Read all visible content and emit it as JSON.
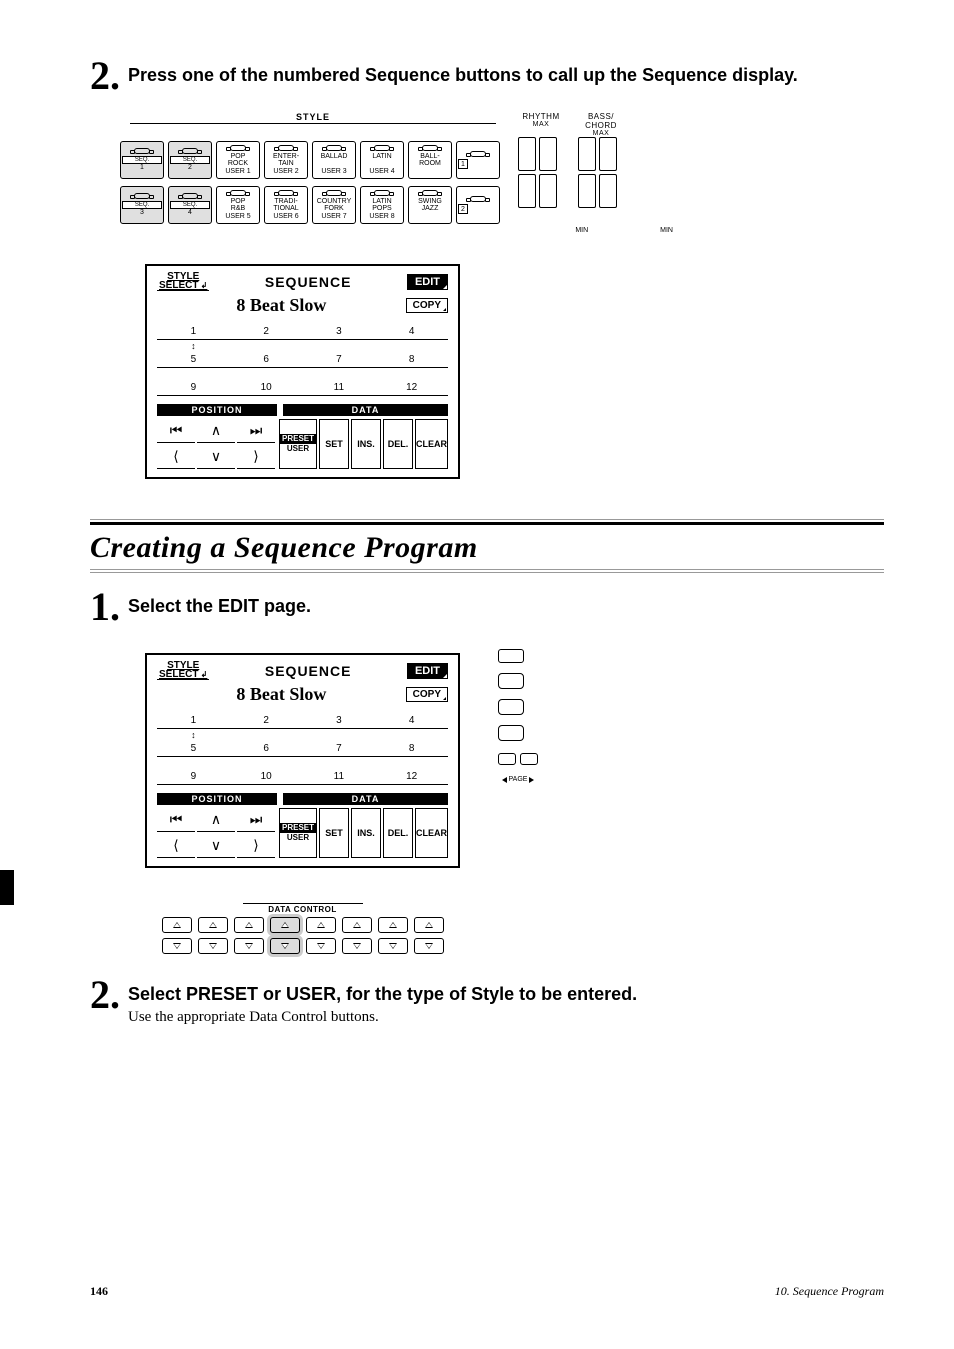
{
  "steps": {
    "s2top": {
      "num": "2.",
      "text": "Press one of the numbered Sequence buttons to call up the Sequence display."
    },
    "s1": {
      "num": "1.",
      "text": "Select the EDIT page."
    },
    "s2bot": {
      "num": "2.",
      "text": "Select PRESET or USER, for the type of Style to be entered.",
      "sub": "Use the appropriate Data Control buttons."
    }
  },
  "section_title": "Creating a Sequence Program",
  "style_panel": {
    "style_label": "STYLE",
    "rhythm_label": "RHYTHM",
    "bass_label": "BASS/\nCHORD",
    "max": "MAX",
    "min": "MIN",
    "row1": [
      {
        "type": "seq",
        "lines": [
          "SEQ.",
          "1"
        ]
      },
      {
        "type": "seq",
        "lines": [
          "SEQ.",
          "2"
        ]
      },
      {
        "type": "std",
        "lines": [
          "POP",
          "ROCK",
          "USER 1"
        ]
      },
      {
        "type": "std",
        "lines": [
          "ENTER-",
          "TAIN",
          "USER 2"
        ]
      },
      {
        "type": "std",
        "lines": [
          "BALLAD",
          "",
          "USER 3"
        ]
      },
      {
        "type": "std",
        "lines": [
          "LATIN",
          "",
          "USER 4"
        ]
      },
      {
        "type": "std",
        "lines": [
          "BALL-",
          "ROOM",
          ""
        ]
      },
      {
        "type": "num",
        "n": "1"
      }
    ],
    "row2": [
      {
        "type": "seq",
        "lines": [
          "SEQ.",
          "3"
        ]
      },
      {
        "type": "seq",
        "lines": [
          "SEQ.",
          "4"
        ]
      },
      {
        "type": "std",
        "lines": [
          "POP",
          "R&B",
          "USER 5"
        ]
      },
      {
        "type": "std",
        "lines": [
          "TRADI-",
          "TIONAL",
          "USER 6"
        ]
      },
      {
        "type": "std",
        "lines": [
          "COUNTRY",
          "FORK",
          "USER 7"
        ]
      },
      {
        "type": "std",
        "lines": [
          "LATIN",
          "POPS",
          "USER 8"
        ]
      },
      {
        "type": "std",
        "lines": [
          "SWING",
          "JAZZ",
          ""
        ]
      },
      {
        "type": "num",
        "n": "2"
      }
    ]
  },
  "seq_display": {
    "style_select": "STYLE\nSELECT",
    "title": "SEQUENCE",
    "edit": "EDIT",
    "style_name": "8 Beat Slow",
    "copy": "COPY",
    "nums": [
      [
        "1",
        "2",
        "3",
        "4"
      ],
      [
        "5",
        "6",
        "7",
        "8"
      ],
      [
        "9",
        "10",
        "11",
        "12"
      ]
    ],
    "position_label": "POSITION",
    "data_label": "DATA",
    "pos_cells": [
      "|⟨⟨",
      "∧",
      "⟩⟩|",
      "⟨",
      "∨",
      "⟩"
    ],
    "data_cells": [
      {
        "type": "split",
        "top": "PRESET",
        "bottom": "USER"
      },
      {
        "type": "plain",
        "label": "SET"
      },
      {
        "type": "plain",
        "label": "INS."
      },
      {
        "type": "plain",
        "label": "DEL."
      },
      {
        "type": "plain",
        "label": "CLEAR"
      }
    ]
  },
  "side": {
    "page_label": "PAGE"
  },
  "data_control": {
    "label": "DATA CONTROL"
  },
  "footer": {
    "page": "146",
    "chapter": "10. Sequence Program"
  }
}
